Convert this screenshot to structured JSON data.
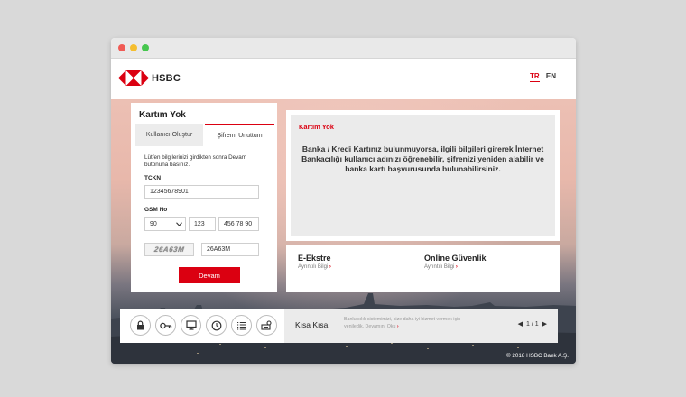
{
  "brand": {
    "name": "HSBC",
    "accent_color": "#db0011"
  },
  "header": {
    "languages": [
      {
        "code": "TR",
        "active": true
      },
      {
        "code": "EN",
        "active": false
      }
    ]
  },
  "login": {
    "title": "Kartım Yok",
    "tabs": [
      {
        "label": "Kullanıcı Oluştur",
        "active": false
      },
      {
        "label": "Şifremi Unuttum",
        "active": true
      }
    ],
    "instructions": "Lütfen bilgilerinizi girdikten sonra Devam butonuna basınız.",
    "tckn_label": "TCKN",
    "tckn_value": "12345678901",
    "gsm_label": "GSM No",
    "gsm_country": "90",
    "gsm_area": "123",
    "gsm_number": "456 78 90",
    "captcha_image_text": "26A63M",
    "captcha_value": "26A63M",
    "submit_label": "Devam"
  },
  "info": {
    "title": "Kartım Yok",
    "text": "Banka / Kredi Kartınız bulunmuyorsa, ilgili bilgileri girerek İnternet Bankacılığı kullanıcı adınızı öğrenebilir, şifrenizi yeniden alabilir ve banka kartı başvurusunda bulunabilirsiniz."
  },
  "links": [
    {
      "title": "E-Ekstre",
      "sub": "Ayrıntılı Bilgi"
    },
    {
      "title": "Online Güvenlik",
      "sub": "Ayrıntılı Bilgi"
    }
  ],
  "shortcuts": [
    {
      "icon": "lock-icon"
    },
    {
      "icon": "key-icon"
    },
    {
      "icon": "monitor-icon"
    },
    {
      "icon": "clock-icon"
    },
    {
      "icon": "list-icon"
    },
    {
      "icon": "keypad-icon"
    }
  ],
  "news": {
    "title": "Kısa Kısa",
    "text": "Bankacılık sistemimizi, size daha iyi hizmet vermek için yeniledik. Devamını Oku",
    "page_current": 1,
    "page_total": 1,
    "pager_text": "1 / 1"
  },
  "footer": {
    "copyright": "© 2018 HSBC Bank A.Ş."
  }
}
